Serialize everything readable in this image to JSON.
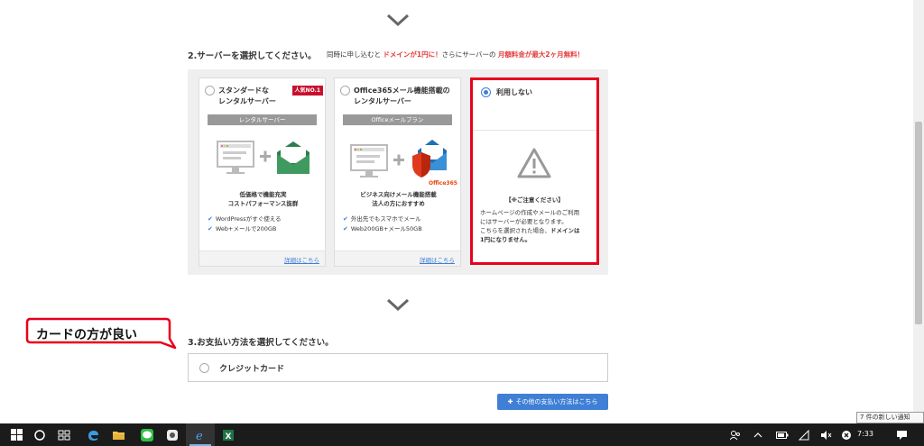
{
  "section2": {
    "heading": "2.サーバーを選択してください。",
    "note_prefix": "同時に申し込むと",
    "note_highlight1": "ドメインが1円に！",
    "note_middle": "さらにサーバーの",
    "note_highlight2": "月額料金が最大2ヶ月無料！"
  },
  "cards": [
    {
      "title_line1": "スタンダードな",
      "title_line2": "レンタルサーバー",
      "badge": "人気NO.1",
      "plan_label": "レンタルサーバー",
      "desc_line1": "低価格で機能充実",
      "desc_line2": "コストパフォーマンス抜群",
      "features": [
        "WordPressがすぐ使える",
        "Web+メールで200GB"
      ],
      "details_link": "詳細はこちら"
    },
    {
      "title_line1": "Office365メール機能搭載の",
      "title_line2": "レンタルサーバー",
      "plan_label": "Officeメールプラン",
      "office_label": "Office365",
      "desc_line1": "ビジネス向けメール機能搭載",
      "desc_line2": "法人の方におすすめ",
      "features": [
        "外出先でもスマホでメール",
        "Web200GB+メール50GB"
      ],
      "details_link": "詳細はこちら"
    }
  ],
  "no_use": {
    "title": "利用しない",
    "selected": true,
    "note_title": "【※ご注意ください】",
    "note_line1": "ホームページの作成やメールのご利用",
    "note_line2": "にはサーバーが必要となります。",
    "note_line3a": "こちらを選択された場合、",
    "note_line3b": "ドメインは",
    "note_line4": "1円になりません。"
  },
  "section3": {
    "heading": "3.お支払い方法を選択してください。",
    "option_label": "クレジットカード",
    "other_button": "その他の支払い方法はこちら"
  },
  "callout": {
    "text": "カードの方が良い"
  },
  "taskbar": {
    "clock": "7:33",
    "icons": [
      "windows-start-icon",
      "cortana-icon",
      "task-view-icon",
      "edge-icon",
      "file-explorer-icon",
      "line-icon",
      "app-icon",
      "ie-icon",
      "excel-icon"
    ],
    "tray_icons": [
      "people-icon",
      "chevron-up-icon",
      "battery-icon",
      "wifi-icon",
      "volume-icon",
      "close-circle-icon",
      "notification-icon"
    ]
  },
  "toast": {
    "text": "7 件の新しい通知"
  },
  "colors": {
    "accent": "#3f7fd6",
    "highlight_red": "#e23c3c",
    "box_red": "#e8001c",
    "badge_red": "#c8102e",
    "taskbar": "#1b1b1b"
  }
}
